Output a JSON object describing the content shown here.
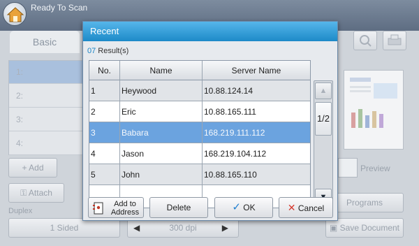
{
  "topbar": {
    "status": "Ready To Scan"
  },
  "background": {
    "tab_basic": "Basic",
    "list_rows": [
      "1:",
      "2:",
      "3:",
      "4:"
    ],
    "add_label": "Add",
    "attach_label": "Attach",
    "duplex_label": "Duplex",
    "duplex_value": "1 Sided",
    "resolution_value": "300 dpi",
    "preview_label": "Preview",
    "programs_label": "Programs",
    "save_document_label": "Save Document"
  },
  "modal": {
    "title": "Recent",
    "results_count": "07",
    "results_label": " Result(s)",
    "columns": [
      "No.",
      "Name",
      "Server Name"
    ],
    "rows": [
      {
        "no": "1",
        "name": "Heywood",
        "server": "10.88.124.14"
      },
      {
        "no": "2",
        "name": "Eric",
        "server": "10.88.165.111"
      },
      {
        "no": "3",
        "name": "Babara",
        "server": "168.219.111.112"
      },
      {
        "no": "4",
        "name": "Jason",
        "server": "168.219.104.112"
      },
      {
        "no": "5",
        "name": "John",
        "server": "10.88.165.110"
      }
    ],
    "page_indicator": "1/2",
    "buttons": {
      "add_to_address": "Add to Address",
      "delete": "Delete",
      "ok": "OK",
      "cancel": "Cancel"
    }
  },
  "colors": {
    "title_bar": "#1d8ac8",
    "selected_row": "#6ba3df"
  }
}
